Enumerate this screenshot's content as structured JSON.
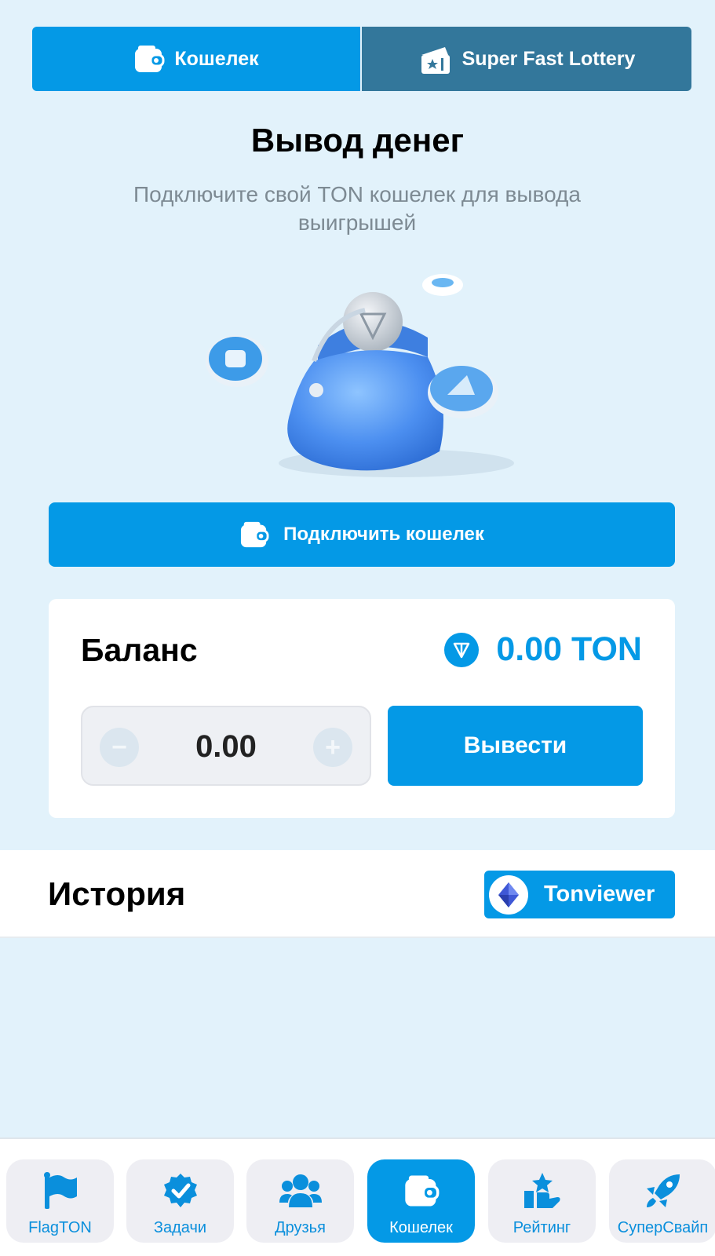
{
  "tabs": [
    {
      "label": "Кошелек",
      "icon": "wallet-icon",
      "active": true
    },
    {
      "label": "Super Fast Lottery",
      "icon": "lottery-ticket-icon",
      "active": false
    }
  ],
  "header": {
    "title": "Вывод денег",
    "subtitle": "Подключите свой TON кошелек для вывода выигрышей"
  },
  "connect_button": {
    "label": "Подключить кошелек",
    "icon": "wallet-icon"
  },
  "balance": {
    "label": "Баланс",
    "amount": "0.00 TON",
    "icon": "ton-icon"
  },
  "withdraw": {
    "value": "0.00",
    "minus": "−",
    "plus": "+",
    "button_label": "Вывести"
  },
  "history": {
    "label": "История",
    "tonviewer_label": "Tonviewer",
    "tonviewer_icon": "tonviewer-diamond-icon"
  },
  "bottom_nav": [
    {
      "label": "FlagTON",
      "icon": "flag-icon",
      "active": false
    },
    {
      "label": "Задачи",
      "icon": "check-badge-icon",
      "active": false
    },
    {
      "label": "Друзья",
      "icon": "friends-icon",
      "active": false
    },
    {
      "label": "Кошелек",
      "icon": "wallet-icon",
      "active": true
    },
    {
      "label": "Рейтинг",
      "icon": "rating-icon",
      "active": false
    },
    {
      "label": "СуперСвайп",
      "icon": "rocket-icon",
      "active": false
    }
  ],
  "colors": {
    "accent": "#0499e6",
    "tab_inactive": "#33779b",
    "background": "#e2f2fb"
  }
}
